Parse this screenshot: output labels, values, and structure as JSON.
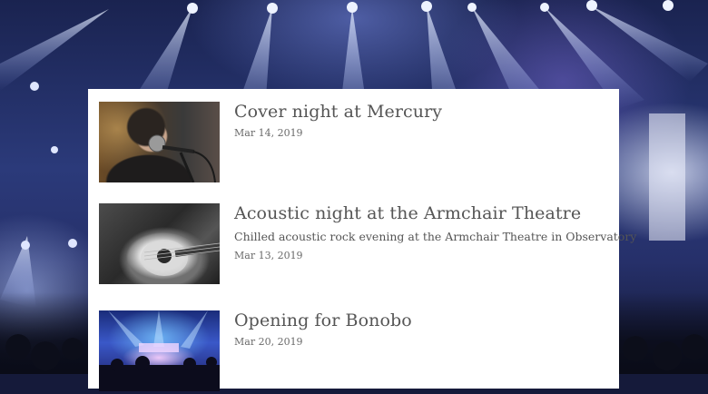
{
  "events": [
    {
      "title": "Cover night at Mercury",
      "description": "",
      "date": "Mar 14, 2019",
      "thumbnail": "singer-with-microphone-photo"
    },
    {
      "title": "Acoustic night at the Armchair Theatre",
      "description": "Chilled acoustic rock evening at the Armchair Theatre in Observatory",
      "date": "Mar 13, 2019",
      "thumbnail": "acoustic-guitar-photo"
    },
    {
      "title": "Opening for Bonobo",
      "description": "",
      "date": "Mar 20, 2019",
      "thumbnail": "concert-stage-photo"
    }
  ]
}
